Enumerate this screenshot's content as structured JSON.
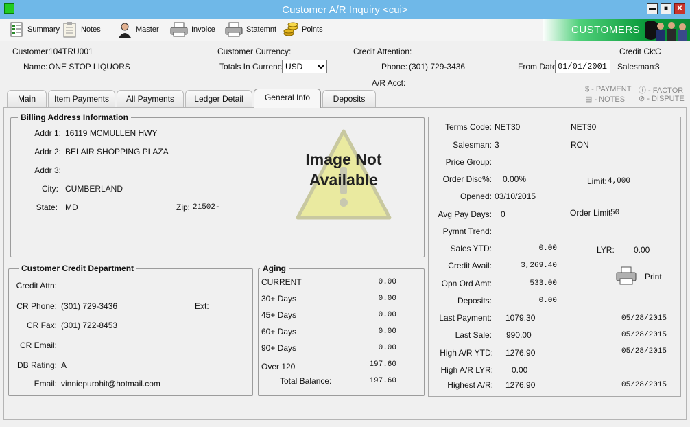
{
  "window": {
    "title": "Customer A/R Inquiry <cui>",
    "min": "▬",
    "max": "■",
    "close": "✕"
  },
  "toolbar": [
    {
      "label": "Summary",
      "icon": "summary-icon"
    },
    {
      "label": "Notes",
      "icon": "notes-icon"
    },
    {
      "label": "Master",
      "icon": "master-icon"
    },
    {
      "label": "Invoice",
      "icon": "invoice-icon"
    },
    {
      "label": "Statemnt",
      "icon": "statement-icon"
    },
    {
      "label": "Points",
      "icon": "points-icon"
    }
  ],
  "brand": "CUSTOMERS",
  "header": {
    "customer_label": "Customer:",
    "customer": "104TRU001",
    "name_label": "Name:",
    "name": "ONE STOP LIQUORS",
    "currency_label": "Customer Currency:",
    "totals_label": "Totals In Currency:",
    "currency_options": [
      "USD"
    ],
    "currency_value": "USD",
    "credit_attention_label": "Credit Attention:",
    "phone_label": "Phone:",
    "phone": "(301) 729-3436",
    "ar_acct_label": "A/R Acct:",
    "credit_ck_label": "Credit Ck:",
    "credit_ck": "C",
    "from_date_label": "From Date:",
    "from_date": "01/01/2001",
    "salesman_label": "Salesman:",
    "salesman": "3"
  },
  "tabs": [
    "Main",
    "Item Payments",
    "All Payments",
    "Ledger Detail",
    "General Info",
    "Deposits"
  ],
  "active_tab": "General Info",
  "legend": {
    "payment": "$ - PAYMENT",
    "notes": "▤ - NOTES",
    "factor": "ⓘ - FACTOR",
    "dispute": "⊘ - DISPUTE"
  },
  "billing": {
    "title": "Billing Address Information",
    "addr1_label": "Addr 1:",
    "addr1": "16119 MCMULLEN HWY",
    "addr2_label": "Addr 2:",
    "addr2": "BELAIR SHOPPING PLAZA",
    "addr3_label": "Addr 3:",
    "addr3": "",
    "city_label": "City:",
    "city": "CUMBERLAND",
    "state_label": "State:",
    "state": "MD",
    "zip_label": "Zip:",
    "zip": "21502-",
    "image_text_1": "Image Not",
    "image_text_2": "Available"
  },
  "credit_dept": {
    "title": "Customer Credit Department",
    "attn_label": "Credit Attn:",
    "attn": "",
    "phone_label": "CR Phone:",
    "phone": "(301) 729-3436",
    "ext_label": "Ext:",
    "ext": "",
    "fax_label": "CR Fax:",
    "fax": "(301) 722-8453",
    "email_label": "CR Email:",
    "email": "",
    "db_label": "DB Rating:",
    "db": "A",
    "email2_label": "Email:",
    "email2": "vinniepurohit@hotmail.com"
  },
  "aging": {
    "title": "Aging",
    "rows": [
      {
        "label": "CURRENT",
        "value": "0.00"
      },
      {
        "label": "30+ Days",
        "value": "0.00"
      },
      {
        "label": "45+ Days",
        "value": "0.00"
      },
      {
        "label": "60+ Days",
        "value": "0.00"
      },
      {
        "label": "90+ Days",
        "value": "0.00"
      },
      {
        "label": "Over 120",
        "value": "197.60"
      }
    ],
    "total_label": "Total Balance:",
    "total": "197.60"
  },
  "right": {
    "terms_label": "Terms Code:",
    "terms": "NET30",
    "terms_desc": "NET30",
    "salesman_label": "Salesman:",
    "salesman": "3",
    "salesman_name": "RON",
    "price_group_label": "Price  Group:",
    "order_disc_label": "Order Disc%:",
    "order_disc": "0.00%",
    "limit_label": "Limit:",
    "limit": "4,000",
    "opened_label": "Opened:",
    "opened": "03/10/2015",
    "avg_pay_label": "Avg Pay Days:",
    "avg_pay": "0",
    "order_limit_label": "Order Limit:",
    "order_limit": "50",
    "pymnt_trend_label": "Pymnt Trend:",
    "sales_ytd_label": "Sales YTD:",
    "sales_ytd": "0.00",
    "lyr_label": "LYR:",
    "lyr": "0.00",
    "credit_avail_label": "Credit Avail:",
    "credit_avail": "3,269.40",
    "print_label": "Print",
    "opn_ord_label": "Opn Ord Amt:",
    "opn_ord": "533.00",
    "deposits_label": "Deposits:",
    "deposits": "0.00",
    "last_payment_label": "Last Payment:",
    "last_payment": "1079.30",
    "last_payment_date": "05/28/2015",
    "last_sale_label": "Last Sale:",
    "last_sale": "990.00",
    "last_sale_date": "05/28/2015",
    "high_ar_ytd_label": "High A/R YTD:",
    "high_ar_ytd": "1276.90",
    "high_ar_ytd_date": "05/28/2015",
    "high_ar_lyr_label": "High A/R LYR:",
    "high_ar_lyr": "0.00",
    "highest_ar_label": "Highest A/R:",
    "highest_ar": "1276.90",
    "highest_ar_date": "05/28/2015"
  },
  "colors": {
    "titlebar": "#6fb8e8",
    "brand": "#0a9a3a",
    "close": "#c8332a"
  }
}
